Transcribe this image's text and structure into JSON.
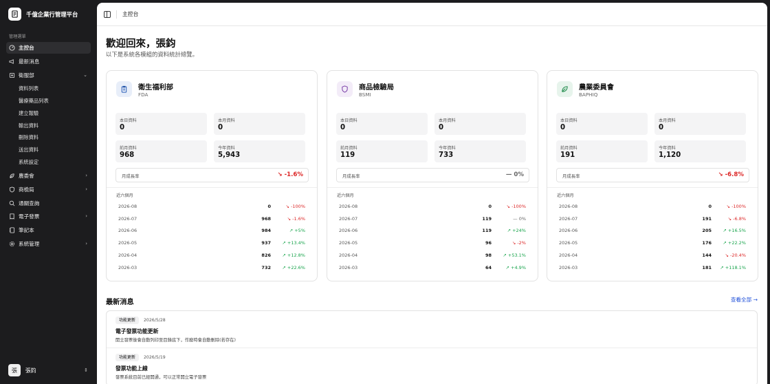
{
  "brand": {
    "name": "千億企業行管理平台"
  },
  "sidebar": {
    "section_label": "管理選單",
    "items": [
      {
        "label": "主控台",
        "icon": "gauge-icon",
        "active": true
      },
      {
        "label": "最新消息",
        "icon": "megaphone-icon"
      },
      {
        "label": "衛服部",
        "icon": "hospital-icon",
        "expanded": true
      },
      {
        "label": "農委會",
        "icon": "leaf-icon"
      },
      {
        "label": "商檢局",
        "icon": "shield-icon"
      },
      {
        "label": "通關查詢",
        "icon": "search-icon"
      },
      {
        "label": "電子發票",
        "icon": "receipt-icon"
      },
      {
        "label": "筆記本",
        "icon": "notebook-icon"
      },
      {
        "label": "系統管理",
        "icon": "gear-icon"
      }
    ],
    "subitems": [
      "資料列表",
      "醫療藥品列表",
      "建立報驗",
      "輸出資料",
      "刪除資料",
      "送出資料",
      "系統設定"
    ]
  },
  "user": {
    "initial": "張",
    "name": "張鈞"
  },
  "topbar": {
    "breadcrumb": "主控台"
  },
  "welcome": {
    "title": "歡迎回來，張鈞",
    "subtitle": "以下是系統各模組的資料統計總覽。"
  },
  "labels": {
    "today": "本日資料",
    "this_month": "本月資料",
    "last_month": "前月資料",
    "this_year": "今年資料",
    "growth": "月成長率",
    "recent": "近六個月"
  },
  "cards": [
    {
      "title": "衛生福利部",
      "code": "FDA",
      "icon": "clipboard-icon",
      "today": "0",
      "this_month": "0",
      "last_month": "968",
      "this_year": "5,943",
      "growth": "-1.6%",
      "growth_dir": "down",
      "months": [
        {
          "month": "2026-08",
          "value": "0",
          "change": "-100%",
          "dir": "down"
        },
        {
          "month": "2026-07",
          "value": "968",
          "change": "-1.6%",
          "dir": "down"
        },
        {
          "month": "2026-06",
          "value": "984",
          "change": "+5%",
          "dir": "up"
        },
        {
          "month": "2026-05",
          "value": "937",
          "change": "+13.4%",
          "dir": "up"
        },
        {
          "month": "2026-04",
          "value": "826",
          "change": "+12.8%",
          "dir": "up"
        },
        {
          "month": "2026-03",
          "value": "732",
          "change": "+22.6%",
          "dir": "up"
        }
      ]
    },
    {
      "title": "商品檢驗局",
      "code": "BSMI",
      "icon": "shield-icon",
      "today": "0",
      "this_month": "0",
      "last_month": "119",
      "this_year": "733",
      "growth": "0%",
      "growth_dir": "flat",
      "months": [
        {
          "month": "2026-08",
          "value": "0",
          "change": "-100%",
          "dir": "down"
        },
        {
          "month": "2026-07",
          "value": "119",
          "change": "0%",
          "dir": "flat"
        },
        {
          "month": "2026-06",
          "value": "119",
          "change": "+24%",
          "dir": "up"
        },
        {
          "month": "2026-05",
          "value": "96",
          "change": "-2%",
          "dir": "down"
        },
        {
          "month": "2026-04",
          "value": "98",
          "change": "+53.1%",
          "dir": "up"
        },
        {
          "month": "2026-03",
          "value": "64",
          "change": "+4.9%",
          "dir": "up"
        }
      ]
    },
    {
      "title": "農業委員會",
      "code": "BAPHIQ",
      "icon": "leaf-icon",
      "today": "0",
      "this_month": "0",
      "last_month": "191",
      "this_year": "1,120",
      "growth": "-6.8%",
      "growth_dir": "down",
      "months": [
        {
          "month": "2026-08",
          "value": "0",
          "change": "-100%",
          "dir": "down"
        },
        {
          "month": "2026-07",
          "value": "191",
          "change": "-6.8%",
          "dir": "down"
        },
        {
          "month": "2026-06",
          "value": "205",
          "change": "+16.5%",
          "dir": "up"
        },
        {
          "month": "2026-05",
          "value": "176",
          "change": "+22.2%",
          "dir": "up"
        },
        {
          "month": "2026-04",
          "value": "144",
          "change": "-20.4%",
          "dir": "down"
        },
        {
          "month": "2026-03",
          "value": "181",
          "change": "+118.1%",
          "dir": "up"
        }
      ]
    }
  ],
  "news": {
    "title": "最新消息",
    "view_all": "查看全部 →",
    "items": [
      {
        "badge": "功能更新",
        "date": "2026/5/28",
        "title": "電子發票功能更新",
        "desc": "開立發票後會自動列印至目錄底下，作廢時會自動刪除(若存在)"
      },
      {
        "badge": "功能更新",
        "date": "2026/5/19",
        "title": "發票功能上線",
        "desc": "發票系統目前已經開通，可以正常開立電子發票"
      }
    ]
  },
  "colors": {
    "up": "#16a34a",
    "down": "#dc2626",
    "card_icon_bg": [
      "#e8eef9",
      "#f3ecf8",
      "#e7f4ec"
    ],
    "card_icon_fg": [
      "#2b5fb8",
      "#7a3fa8",
      "#1f8a4a"
    ]
  }
}
